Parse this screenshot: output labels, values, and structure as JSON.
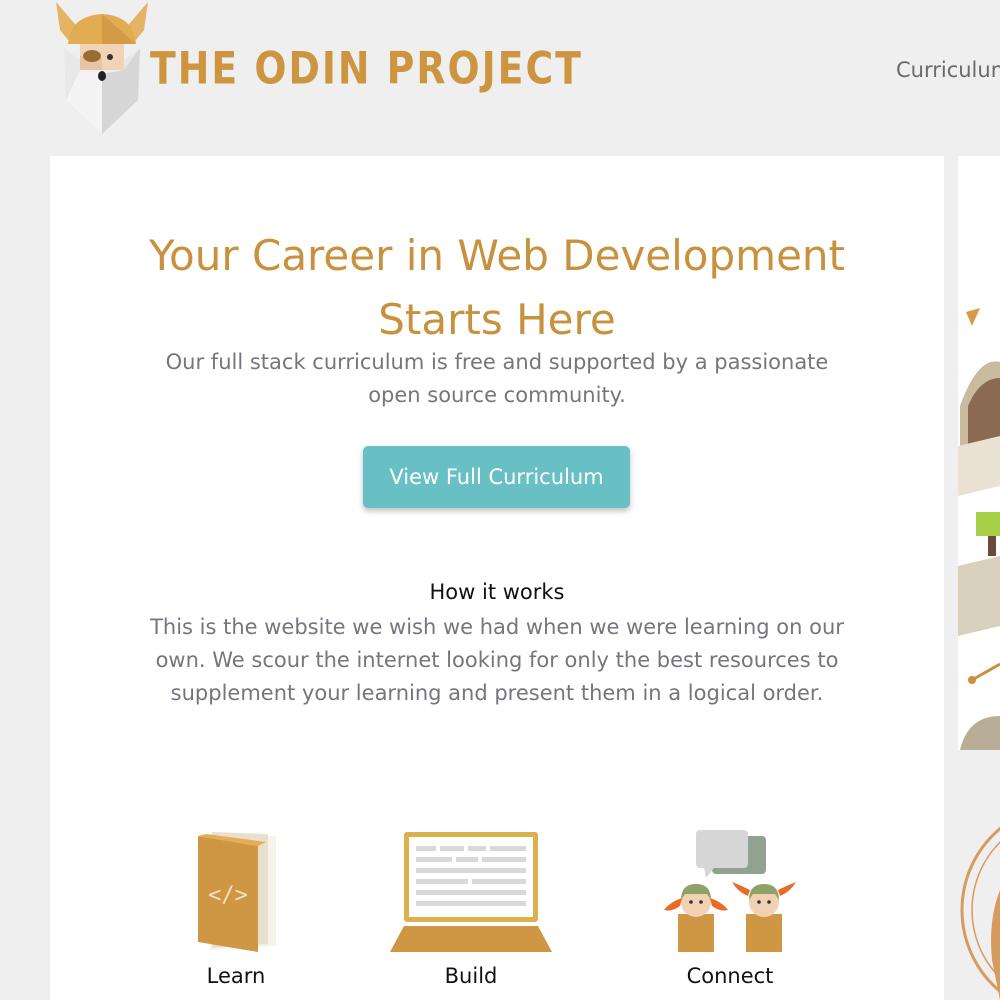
{
  "header": {
    "brand": "THE ODIN PROJECT",
    "logo_icon": "odin-viking-head-icon",
    "nav": [
      {
        "label": "Curriculum"
      }
    ]
  },
  "hero": {
    "title_line1": "Your Career in Web Development",
    "title_line2": "Starts Here",
    "subtitle_line1": "Our full stack curriculum is free and supported by a passionate",
    "subtitle_line2": "open source community.",
    "cta_label": "View Full Curriculum"
  },
  "how_it_works": {
    "title": "How it works",
    "text_line1": "This is the website we wish we had when we were learning on our",
    "text_line2": "own. We scour the internet looking for only the best resources to",
    "text_line3": "supplement your learning and present them in a logical order."
  },
  "features": [
    {
      "label": "Learn",
      "icon": "code-book-icon"
    },
    {
      "label": "Build",
      "icon": "laptop-icon"
    },
    {
      "label": "Connect",
      "icon": "people-chat-icon"
    }
  ],
  "colors": {
    "brand_gold": "#cd953f",
    "title_gold": "#c8913e",
    "cta_teal": "#68c0c5",
    "muted_text": "#76747f",
    "background": "#efefef"
  }
}
